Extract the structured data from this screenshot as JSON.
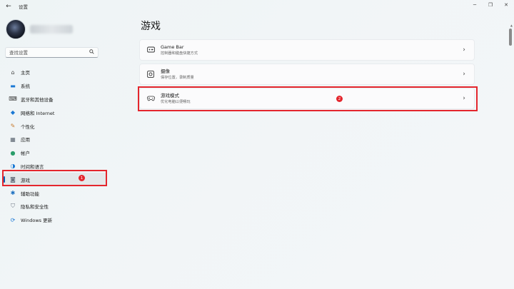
{
  "window": {
    "back_glyph": "←",
    "title": "设置",
    "min_glyph": "─",
    "max_glyph": "❐",
    "close_glyph": "✕"
  },
  "search": {
    "placeholder": "查找设置"
  },
  "sidebar": {
    "items": [
      {
        "label": "主页",
        "icon": "home-icon",
        "glyph": "⌂",
        "color": "#444444"
      },
      {
        "label": "系统",
        "icon": "system-icon",
        "glyph": "▬",
        "color": "#1a78d4"
      },
      {
        "label": "蓝牙和其他设备",
        "icon": "bluetooth-devices-icon",
        "glyph": "⌨",
        "color": "#3a3a3a"
      },
      {
        "label": "网络和 Internet",
        "icon": "network-icon",
        "glyph": "◆",
        "color": "#1a78d4"
      },
      {
        "label": "个性化",
        "icon": "personalization-icon",
        "glyph": "✎",
        "color": "#c77a2e"
      },
      {
        "label": "应用",
        "icon": "apps-icon",
        "glyph": "▦",
        "color": "#5a6470"
      },
      {
        "label": "帐户",
        "icon": "accounts-icon",
        "glyph": "●",
        "color": "#2a9d6a"
      },
      {
        "label": "时间和语言",
        "icon": "time-language-icon",
        "glyph": "◑",
        "color": "#1a78d4"
      },
      {
        "label": "游戏",
        "icon": "gaming-icon",
        "glyph": "◙",
        "color": "#6a7480",
        "selected": true
      },
      {
        "label": "辅助功能",
        "icon": "accessibility-icon",
        "glyph": "✱",
        "color": "#1a6fc0"
      },
      {
        "label": "隐私和安全性",
        "icon": "privacy-shield-icon",
        "glyph": "⛉",
        "color": "#6a7480"
      },
      {
        "label": "Windows 更新",
        "icon": "windows-update-icon",
        "glyph": "⟳",
        "color": "#1a78d4"
      }
    ]
  },
  "main": {
    "title": "游戏",
    "cards": [
      {
        "title": "Game Bar",
        "subtitle": "控制器和键盘快捷方式",
        "icon": "game-bar-icon"
      },
      {
        "title": "摄像",
        "subtitle": "保存位置，录制质量",
        "icon": "captures-icon"
      },
      {
        "title": "游戏模式",
        "subtitle": "优化电脑以便畅玩",
        "icon": "game-mode-icon"
      }
    ],
    "chevron": "›"
  },
  "annotations": {
    "badge1": "1",
    "badge2": "2",
    "highlight_color": "#e4262d"
  }
}
